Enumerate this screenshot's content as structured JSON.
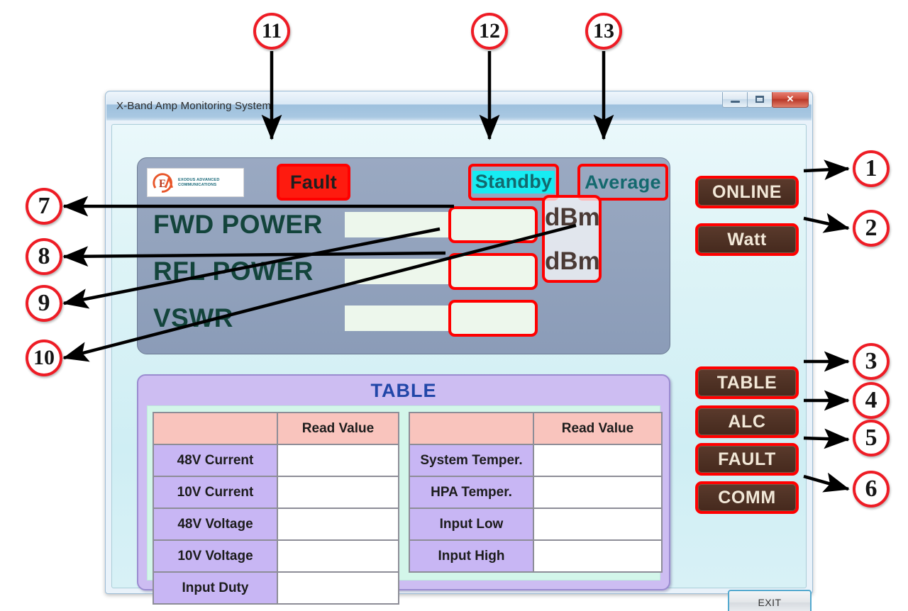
{
  "window": {
    "title": "X-Band Amp Monitoring System",
    "controls": {
      "minimize": "minimize-button",
      "maximize": "maximize-button",
      "close": "✕"
    }
  },
  "logo": {
    "mark": "EA",
    "line1": "EXODUS ADVANCED",
    "line2": "COMMUNICATIONS"
  },
  "status_chips": [
    {
      "id": "fault",
      "label": "Fault",
      "background": "#fe1b0f",
      "text_color": "#1f1f1f",
      "active": true
    },
    {
      "id": "standby",
      "label": "Standby",
      "background": "#17ecf2",
      "text_color": "#13696e",
      "active": true
    },
    {
      "id": "average",
      "label": "Average",
      "background": "transparent",
      "text_color": "#13696e",
      "active": false
    }
  ],
  "readouts": [
    {
      "label": "FWD POWER",
      "value": "",
      "unit": "dBm"
    },
    {
      "label": "RFL POWER",
      "value": "",
      "unit": "dBm"
    },
    {
      "label": "VSWR",
      "value": "",
      "unit": ""
    }
  ],
  "units": {
    "unit1": "dBm",
    "unit2": "dBm"
  },
  "table": {
    "title": "TABLE",
    "left": {
      "headers": [
        "",
        "Read Value"
      ],
      "rows": [
        {
          "label": "48V Current",
          "value": ""
        },
        {
          "label": "10V Current",
          "value": ""
        },
        {
          "label": "48V Voltage",
          "value": ""
        },
        {
          "label": "10V Voltage",
          "value": ""
        },
        {
          "label": "Input Duty",
          "value": ""
        }
      ]
    },
    "right": {
      "headers": [
        "",
        "Read Value"
      ],
      "rows": [
        {
          "label": "System Temper.",
          "value": ""
        },
        {
          "label": "HPA Temper.",
          "value": ""
        },
        {
          "label": "Input Low",
          "value": ""
        },
        {
          "label": "Input High",
          "value": ""
        }
      ]
    }
  },
  "control_buttons": [
    {
      "id": "online",
      "label": "ONLINE"
    },
    {
      "id": "watt",
      "label": "Watt"
    },
    {
      "id": "table",
      "label": "TABLE"
    },
    {
      "id": "alc",
      "label": "ALC"
    },
    {
      "id": "fault",
      "label": "FAULT"
    },
    {
      "id": "comm",
      "label": "COMM"
    }
  ],
  "exit_button": {
    "label": "EXIT"
  },
  "annotations": [
    {
      "num": "1",
      "target": "online-button"
    },
    {
      "num": "2",
      "target": "watt-button"
    },
    {
      "num": "3",
      "target": "table-button"
    },
    {
      "num": "4",
      "target": "alc-button"
    },
    {
      "num": "5",
      "target": "fault-button"
    },
    {
      "num": "6",
      "target": "comm-button"
    },
    {
      "num": "7",
      "target": "fwd-power-readout"
    },
    {
      "num": "8",
      "target": "rfl-power-readout"
    },
    {
      "num": "9",
      "target": "vswr-readout"
    },
    {
      "num": "10",
      "target": "unit-group"
    },
    {
      "num": "11",
      "target": "fault-status-chip"
    },
    {
      "num": "12",
      "target": "standby-status-chip"
    },
    {
      "num": "13",
      "target": "average-status-chip"
    }
  ],
  "colors": {
    "annotation_red": "#ee1c25",
    "button_brown": "#4e3124",
    "panel_slate": "#93a3bd",
    "table_lavender": "#cdbdf2",
    "header_pink": "#f9c4bd",
    "client_cyan": "#dff4f7"
  }
}
